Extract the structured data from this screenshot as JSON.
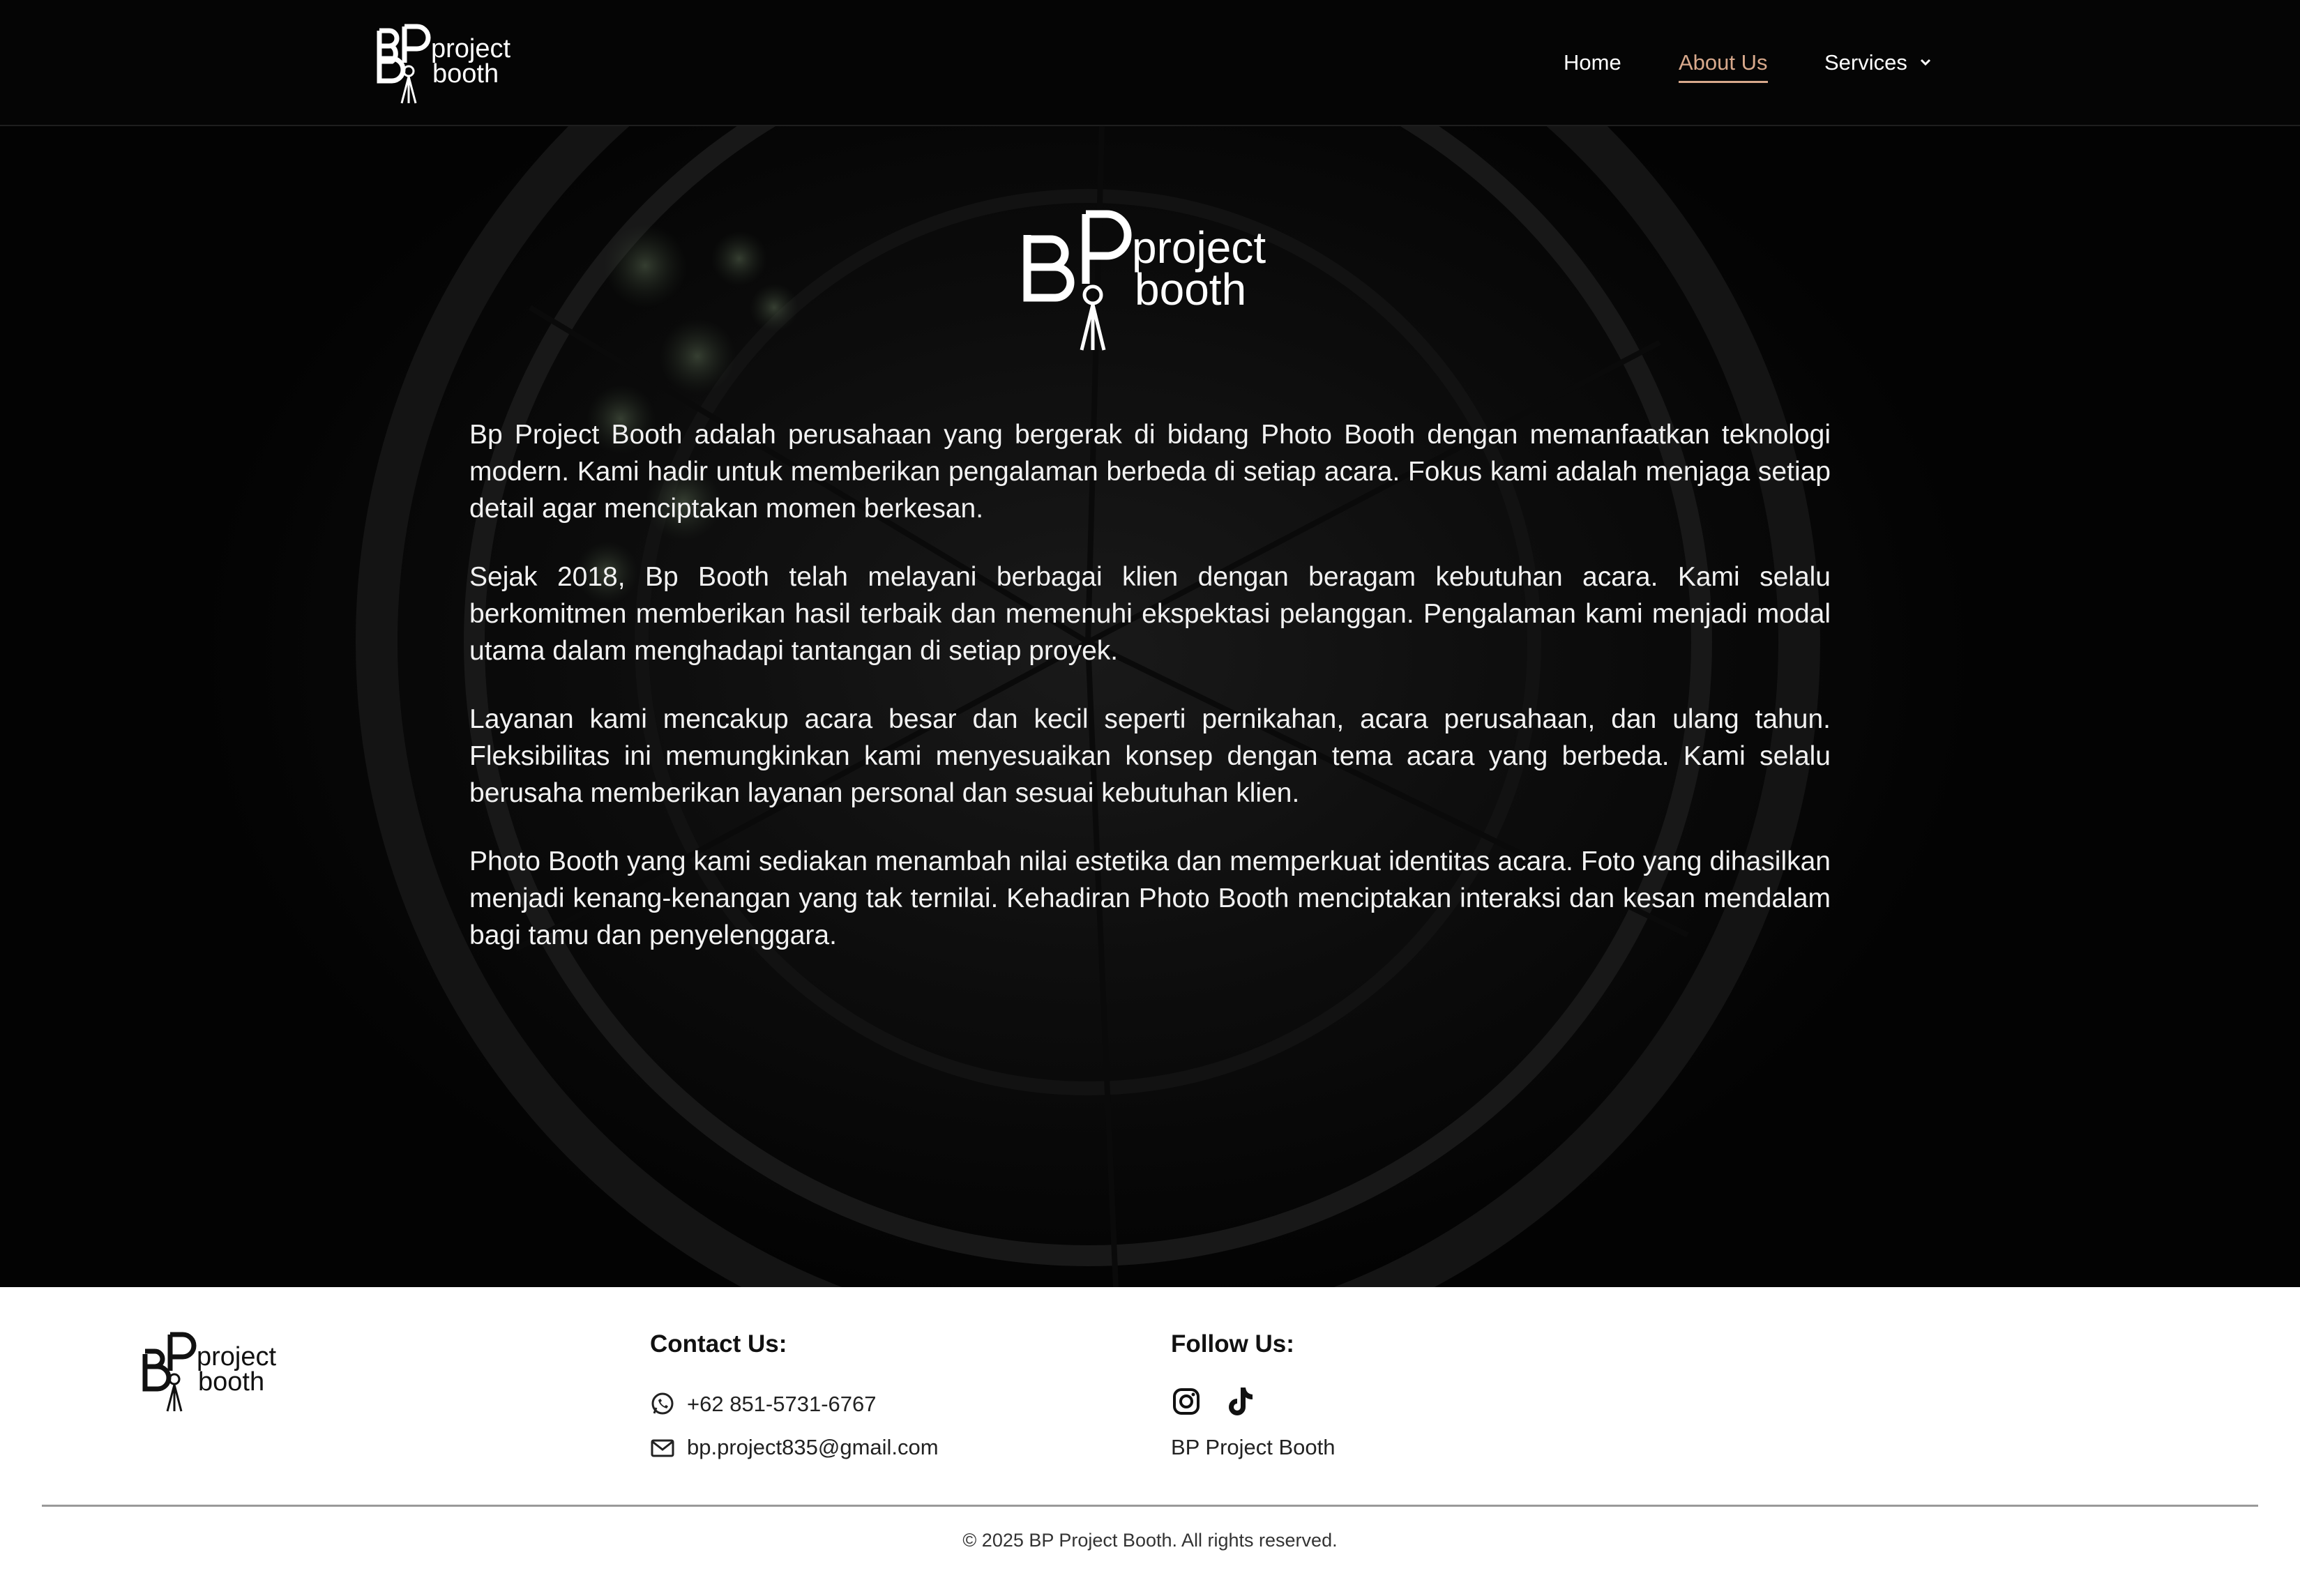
{
  "brand": {
    "logo_monogram": "BP",
    "logo_line1": "project",
    "logo_line2": "booth"
  },
  "nav": {
    "items": [
      {
        "label": "Home"
      },
      {
        "label": "About Us",
        "active": true
      },
      {
        "label": "Services",
        "has_dropdown": true
      }
    ],
    "active_color": "#d8a98c"
  },
  "about": {
    "paragraphs": [
      "Bp Project Booth adalah perusahaan yang bergerak di bidang Photo Booth dengan memanfaatkan teknologi modern. Kami hadir untuk memberikan pengalaman berbeda di setiap acara. Fokus kami adalah menjaga setiap detail agar menciptakan momen berkesan.",
      "Sejak 2018, Bp Booth telah melayani berbagai klien dengan beragam kebutuhan acara. Kami selalu berkomitmen memberikan hasil terbaik dan memenuhi ekspektasi pelanggan. Pengalaman kami menjadi modal utama dalam menghadapi tantangan di setiap proyek.",
      "Layanan kami mencakup acara besar dan kecil seperti pernikahan, acara perusahaan, dan ulang tahun. Fleksibilitas ini memungkinkan kami menyesuaikan konsep dengan tema acara yang berbeda. Kami selalu berusaha memberikan layanan personal dan sesuai kebutuhan klien.",
      "Photo Booth yang kami sediakan menambah nilai estetika dan memperkuat identitas acara. Foto yang dihasilkan menjadi kenang-kenangan yang tak ternilai. Kehadiran Photo Booth menciptakan interaksi dan kesan mendalam bagi tamu dan penyelenggara."
    ]
  },
  "footer": {
    "contact_heading": "Contact Us:",
    "phone": "+62 851-5731-6767",
    "email": "bp.project835@gmail.com",
    "follow_heading": "Follow Us:",
    "social_icons": [
      "instagram-icon",
      "tiktok-icon"
    ],
    "social_name": "BP Project Booth",
    "copyright": "© 2025 BP Project Booth. All rights reserved."
  }
}
